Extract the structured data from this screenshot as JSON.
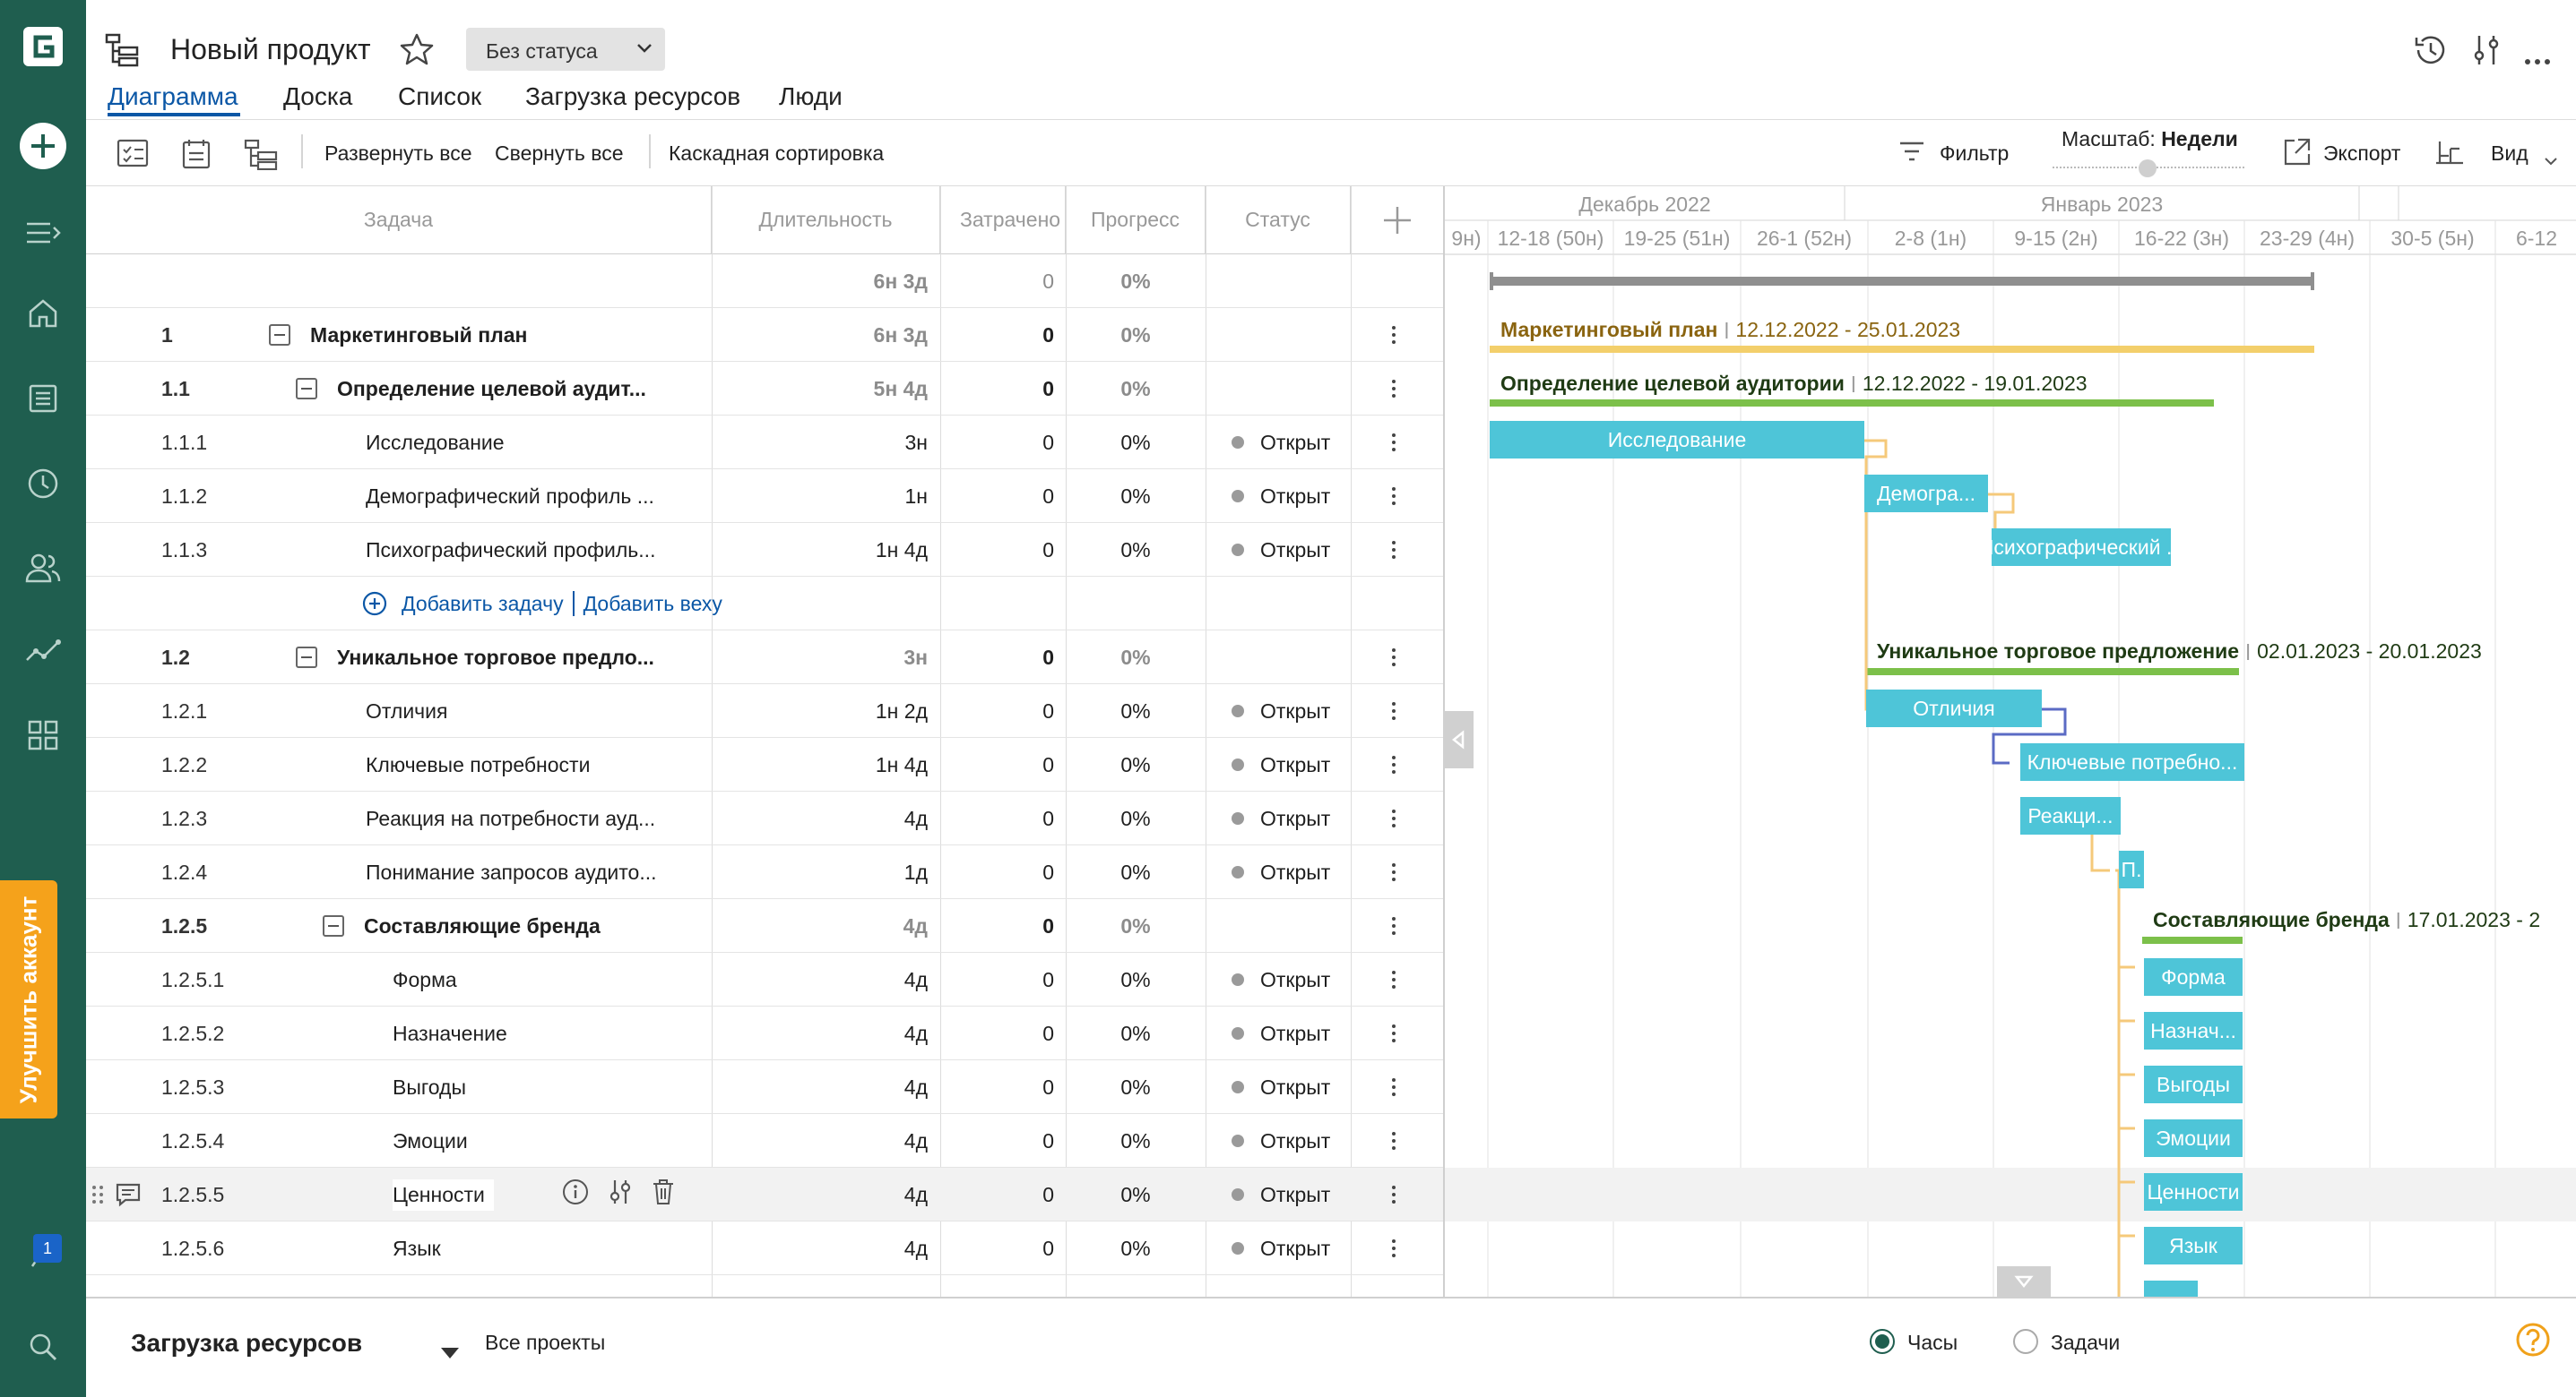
{
  "header": {
    "project_title": "Новый продукт",
    "status": "Без статуса",
    "tabs": [
      "Диаграмма",
      "Доска",
      "Список",
      "Загрузка ресурсов",
      "Люди"
    ],
    "active_tab": "Диаграмма"
  },
  "toolbar": {
    "expand_all": "Развернуть все",
    "collapse_all": "Свернуть все",
    "cascade_sort": "Каскадная сортировка",
    "filter": "Фильтр",
    "scale_label": "Масштаб:",
    "scale_value": "Недели",
    "export": "Экспорт",
    "view": "Вид"
  },
  "sidebar": {
    "upgrade": "Улучшить аккаунт",
    "notifications": "1"
  },
  "grid": {
    "columns": [
      "Задача",
      "Длительность",
      "Затрачено",
      "Прогресс",
      "Статус"
    ],
    "rows": [
      {
        "num": "",
        "name": "",
        "dur": "6н 3д",
        "spent": "0",
        "prog": "0%",
        "status": "",
        "level": 0,
        "type": "total"
      },
      {
        "num": "1",
        "name": "Маркетинговый план",
        "dur": "6н 3д",
        "spent": "0",
        "prog": "0%",
        "status": "",
        "level": 0,
        "type": "group"
      },
      {
        "num": "1.1",
        "name": "Определение целевой аудит...",
        "dur": "5н 4д",
        "spent": "0",
        "prog": "0%",
        "status": "",
        "level": 1,
        "type": "group"
      },
      {
        "num": "1.1.1",
        "name": "Исследование",
        "dur": "3н",
        "spent": "0",
        "prog": "0%",
        "status": "Открыт",
        "level": 2,
        "type": "task"
      },
      {
        "num": "1.1.2",
        "name": "Демографический профиль ...",
        "dur": "1н",
        "spent": "0",
        "prog": "0%",
        "status": "Открыт",
        "level": 2,
        "type": "task"
      },
      {
        "num": "1.1.3",
        "name": "Психографический профиль...",
        "dur": "1н 4д",
        "spent": "0",
        "prog": "0%",
        "status": "Открыт",
        "level": 2,
        "type": "task"
      },
      {
        "num": "",
        "name": "",
        "dur": "",
        "spent": "",
        "prog": "",
        "status": "",
        "level": 2,
        "type": "add"
      },
      {
        "num": "1.2",
        "name": "Уникальное торговое предло...",
        "dur": "3н",
        "spent": "0",
        "prog": "0%",
        "status": "",
        "level": 1,
        "type": "group"
      },
      {
        "num": "1.2.1",
        "name": "Отличия",
        "dur": "1н 2д",
        "spent": "0",
        "prog": "0%",
        "status": "Открыт",
        "level": 2,
        "type": "task"
      },
      {
        "num": "1.2.2",
        "name": "Ключевые потребности",
        "dur": "1н 4д",
        "spent": "0",
        "prog": "0%",
        "status": "Открыт",
        "level": 2,
        "type": "task"
      },
      {
        "num": "1.2.3",
        "name": "Реакция на потребности ауд...",
        "dur": "4д",
        "spent": "0",
        "prog": "0%",
        "status": "Открыт",
        "level": 2,
        "type": "task"
      },
      {
        "num": "1.2.4",
        "name": "Понимание запросов аудито...",
        "dur": "1д",
        "spent": "0",
        "prog": "0%",
        "status": "Открыт",
        "level": 2,
        "type": "task"
      },
      {
        "num": "1.2.5",
        "name": "Составляющие бренда",
        "dur": "4д",
        "spent": "0",
        "prog": "0%",
        "status": "",
        "level": 2,
        "type": "group"
      },
      {
        "num": "1.2.5.1",
        "name": "Форма",
        "dur": "4д",
        "spent": "0",
        "prog": "0%",
        "status": "Открыт",
        "level": 3,
        "type": "task"
      },
      {
        "num": "1.2.5.2",
        "name": "Назначение",
        "dur": "4д",
        "spent": "0",
        "prog": "0%",
        "status": "Открыт",
        "level": 3,
        "type": "task"
      },
      {
        "num": "1.2.5.3",
        "name": "Выгоды",
        "dur": "4д",
        "spent": "0",
        "prog": "0%",
        "status": "Открыт",
        "level": 3,
        "type": "task"
      },
      {
        "num": "1.2.5.4",
        "name": "Эмоции",
        "dur": "4д",
        "spent": "0",
        "prog": "0%",
        "status": "Открыт",
        "level": 3,
        "type": "task"
      },
      {
        "num": "1.2.5.5",
        "name": "Ценности",
        "dur": "4д",
        "spent": "0",
        "prog": "0%",
        "status": "Открыт",
        "level": 3,
        "type": "task",
        "selected": true
      },
      {
        "num": "1.2.5.6",
        "name": "Язык",
        "dur": "4д",
        "spent": "0",
        "prog": "0%",
        "status": "Открыт",
        "level": 3,
        "type": "task"
      }
    ],
    "add_task": "Добавить задачу",
    "add_milestone": "Добавить веху"
  },
  "gantt": {
    "months": [
      "Декабрь 2022",
      "Январь 2023"
    ],
    "weeks": [
      "9н)",
      "12-18 (50н)",
      "19-25 (51н)",
      "26-1 (52н)",
      "2-8 (1н)",
      "9-15 (2н)",
      "16-22 (3н)",
      "23-29 (4н)",
      "30-5 (5н)",
      "6-12"
    ],
    "summaries": [
      {
        "name": "Маркетинговый план",
        "dates": "12.12.2022 - 25.01.2023"
      },
      {
        "name": "Определение целевой аудитории",
        "dates": "12.12.2022 - 19.01.2023"
      },
      {
        "name": "Уникальное торговое предложение",
        "dates": "02.01.2023 - 20.01.2023"
      },
      {
        "name": "Составляющие бренда",
        "dates": "17.01.2023 - 2"
      }
    ],
    "bars": [
      "Исследование",
      "Демогра...",
      "Психографический ...",
      "Отличия",
      "Ключевые потребно...",
      "Реакци...",
      "П.",
      "Форма",
      "Назнач...",
      "Выгоды",
      "Эмоции",
      "Ценности",
      "Язык"
    ],
    "colors": {
      "task": "#4ec5d8",
      "summary_top": "#f3cf6b",
      "summary": "#7cc04a",
      "total": "#8f8f8f",
      "link": "#f5c97a",
      "link_blue": "#5b6bc4"
    }
  },
  "bottom": {
    "title": "Загрузка ресурсов",
    "projects": "Все проекты",
    "radio_hours": "Часы",
    "radio_tasks": "Задачи"
  }
}
